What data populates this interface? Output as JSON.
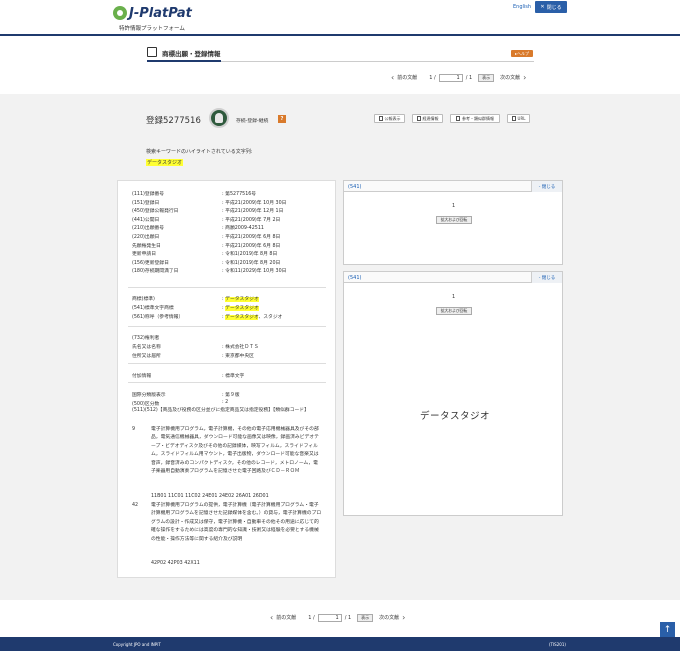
{
  "header": {
    "logo_text": "J-PlatPat",
    "logo_sub": "特許情報プラットフォーム",
    "english_link": "English",
    "close_label": "閉じる"
  },
  "page": {
    "title": "商標出願・登録情報",
    "help_label": "ヘルプ"
  },
  "pager_top": {
    "prev": "前の文献",
    "current": "1",
    "sep": "1 /",
    "total": "/ 1",
    "show": "表示",
    "next": "次の文献"
  },
  "pager_bottom": {
    "prev": "前の文献",
    "current": "1",
    "sep": "1 /",
    "total": "/ 1",
    "show": "表示",
    "next": "次の文献"
  },
  "record": {
    "reg_title": "登録5277516",
    "status_text": "存続-登録-継続",
    "status_help": "?",
    "buttons": [
      "公報表示",
      "経過情報",
      "参考・類似群情報",
      "URL"
    ]
  },
  "keyword": {
    "label": "検索キーワードのハイライトされている文字列:",
    "value": "データスタジオ"
  },
  "fields": [
    {
      "k": "(111)登録番号",
      "v": ": 第5277516号"
    },
    {
      "k": "(151)登録日",
      "v": ": 平成21(2009)年 10月 30日"
    },
    {
      "k": "(450)登録公報発行日",
      "v": ": 平成21(2009)年 12月 1日"
    },
    {
      "k": "(441)公開日",
      "v": ": 平成21(2009)年 7月 2日"
    },
    {
      "k": "(210)出願番号",
      "v": ": 商願2009-42511"
    },
    {
      "k": "(220)出願日",
      "v": ": 平成21(2009)年 6月 8日"
    },
    {
      "k": "先願権発生日",
      "v": ": 平成21(2009)年 6月 8日"
    },
    {
      "k": "更新申請日",
      "v": ": 令和1(2019)年 8月 8日"
    },
    {
      "k": "(156)更新登録日",
      "v": ": 令和1(2019)年 8月 20日"
    },
    {
      "k": "(180)存続期間満了日",
      "v": ": 令和11(2029)年 10月 30日"
    }
  ],
  "names": [
    {
      "k": "商標(標準)",
      "v": "データスタジオ",
      "pre": ": ",
      "post": ""
    },
    {
      "k": "(541)標準文字商標",
      "v": "データスタジオ",
      "pre": ": ",
      "post": ""
    },
    {
      "k": "(561)称呼（参考情報）",
      "v": "データスタジオ",
      "pre": ": ",
      "post": "、スタジオ"
    }
  ],
  "owner": {
    "section": "(732)権利者",
    "name_k": "氏名又は名称",
    "name_v": ": 株式会社ＤＴＳ",
    "addr_k": "住所又は居所",
    "addr_v": ": 東京都中央区"
  },
  "extra": {
    "k": "付加情報",
    "v": ": 標準文字"
  },
  "classification": [
    {
      "k": "国際分類版表示",
      "v": ": 第９版"
    },
    {
      "k": "(500)区分数",
      "v": ": 2"
    }
  ],
  "goods_header": "(511)(512)【商品及び役務の区分並びに指定商品又は指定役務】【類似群コード】",
  "goods": [
    {
      "cls": "9",
      "text": "電子計算機用プログラム，電子計算機，その他の電子応用機械器具及びその部品，電気通信機械器具，ダウンロード可能な画像又は映像，録画済みビデオテープ・ビデオディスク及びその他の記録媒体，映写フィルム，スライドフィルム，スライドフィルム用マウント，電子出版物，ダウンロード可能な音楽又は音声，録音済みのコンパクトディスク，その他のレコード，メトロノーム，電子楽器用自動演奏プログラムを記憶させた電子回路及びＣＤ－ＲＯＭ",
      "codes": "11B01 11C01 11C02 24E01 24E02 26A01 26D01"
    },
    {
      "cls": "42",
      "text": "電子計算機用プログラムの提供，電子計算機（電子計算機用プログラム・電子計算機用プログラムを記憶させた記録媒体を含む。）の貸与，電子計算機のプログラムの設計・作成又は保守，電子計算機・自動車その他その用途に応じて的確な操作をするためには高度の専門的な知識・技術又は経験を必要とする機械の性能・操作方法等に関する紹介及び説明",
      "codes": "42P02 42P03 42X11"
    }
  ],
  "right_panels": [
    {
      "label": "(541)",
      "close": "- 閉じる",
      "num": "1",
      "zoom": "拡大および回転"
    },
    {
      "label": "(541)",
      "close": "- 閉じる",
      "num": "1",
      "zoom": "拡大および回転",
      "mark": "データスタジオ"
    }
  ],
  "footer": {
    "copyright": "Copyright JPO and INPIT",
    "code": "(TIS201)"
  },
  "to_top": "↑"
}
